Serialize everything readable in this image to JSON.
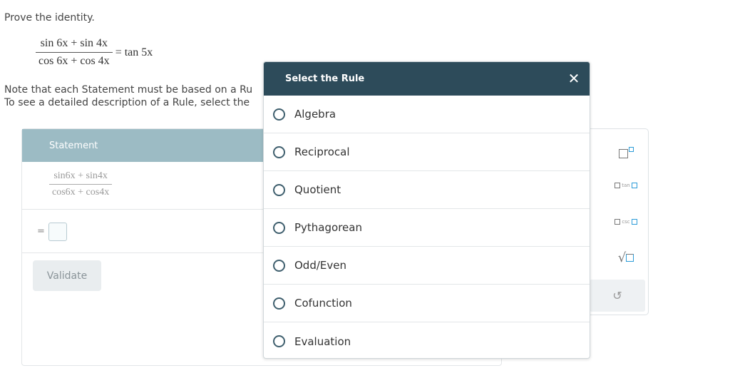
{
  "prompt": "Prove the identity.",
  "identity": {
    "lhs_num": "sin 6x + sin 4x",
    "lhs_den": "cos 6x + cos 4x",
    "rhs": "= tan 5x"
  },
  "note": {
    "line1": "Note that each Statement must be based on a Ru",
    "line2": "To see a detailed description of a Rule, select the"
  },
  "proof": {
    "header": "Statement",
    "first_statement_num": "sin6x + sin4x",
    "first_statement_den": "cos6x + cos4x",
    "equals": "=",
    "validate_label": "Validate"
  },
  "tools": {
    "tan_label": "tan",
    "csc_label": "csc",
    "sqrt_symbol": "√",
    "undo_symbol": "↺"
  },
  "modal": {
    "title": "Select the Rule",
    "close_symbol": "✕",
    "options": [
      {
        "label": "Algebra"
      },
      {
        "label": "Reciprocal"
      },
      {
        "label": "Quotient"
      },
      {
        "label": "Pythagorean"
      },
      {
        "label": "Odd/Even"
      },
      {
        "label": "Cofunction"
      },
      {
        "label": "Evaluation"
      }
    ]
  }
}
